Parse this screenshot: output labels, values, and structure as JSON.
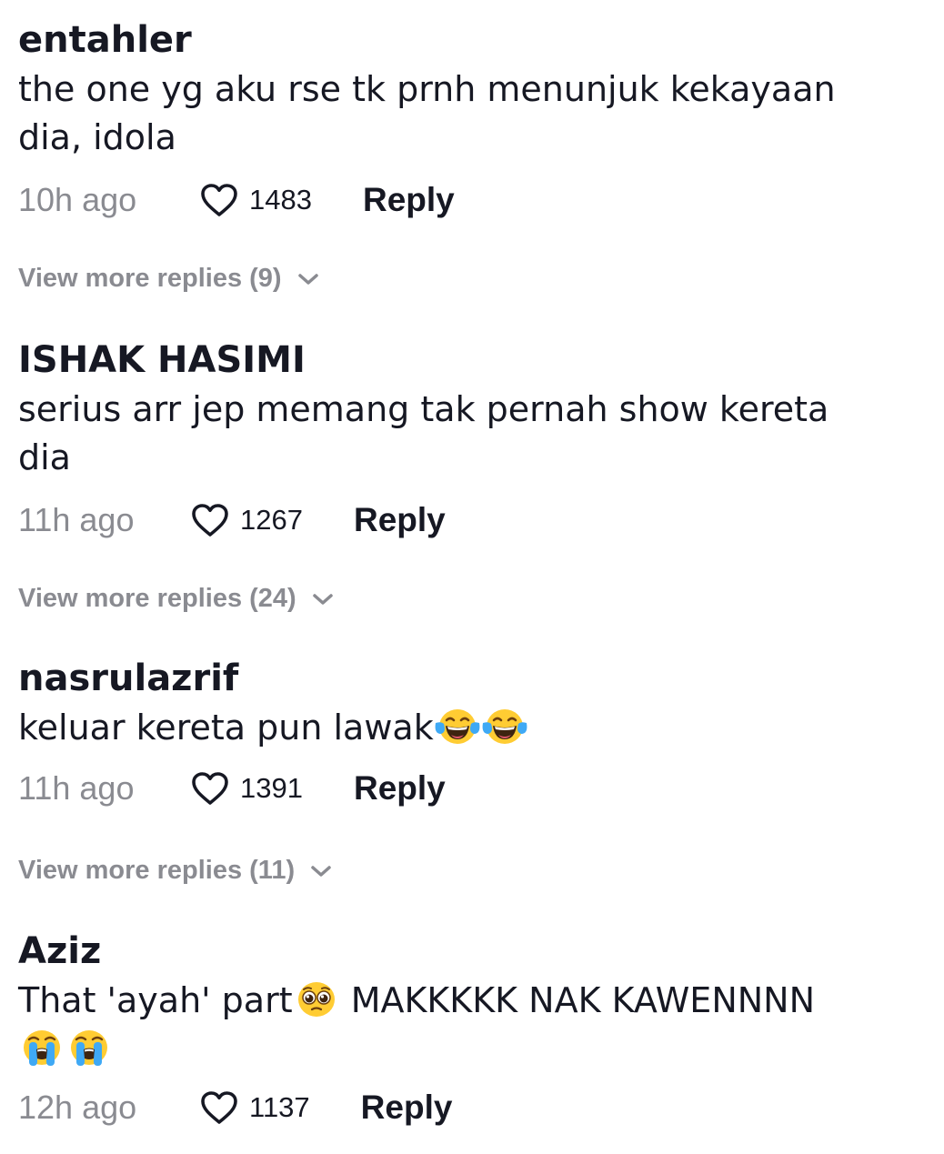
{
  "comments": [
    {
      "username": "entahler",
      "text_line1": "the one yg aku rse tk prnh menunjuk kekayaan",
      "text_line2": "dia, idola",
      "time": "10h ago",
      "likes": "1483",
      "reply_label": "Reply",
      "view_more": "View more replies (9)"
    },
    {
      "username": "ISHAK HASIMI",
      "text_line1": "serius arr jep memang tak pernah show kereta",
      "text_line2": "dia",
      "time": "11h ago",
      "likes": "1267",
      "reply_label": "Reply",
      "view_more": "View more replies (24)"
    },
    {
      "username": "nasrulazrif",
      "text": "keluar kereta pun lawak",
      "emojis": [
        "face-with-tears-of-joy-emoji",
        "face-with-tears-of-joy-emoji"
      ],
      "time": "11h ago",
      "likes": "1391",
      "reply_label": "Reply",
      "view_more": "View more replies (11)"
    },
    {
      "username": "Aziz",
      "text_part1": "That 'ayah' part",
      "emoji_mid": "pleading-face-emoji",
      "text_part2": " MAKKKKK NAK KAWENNNN",
      "emojis_end": [
        "loudly-crying-face-emoji",
        "loudly-crying-face-emoji"
      ],
      "time": "12h ago",
      "likes": "1137",
      "reply_label": "Reply"
    }
  ],
  "colors": {
    "text_primary": "#161823",
    "text_secondary": "#8a8b91",
    "background": "#ffffff"
  }
}
